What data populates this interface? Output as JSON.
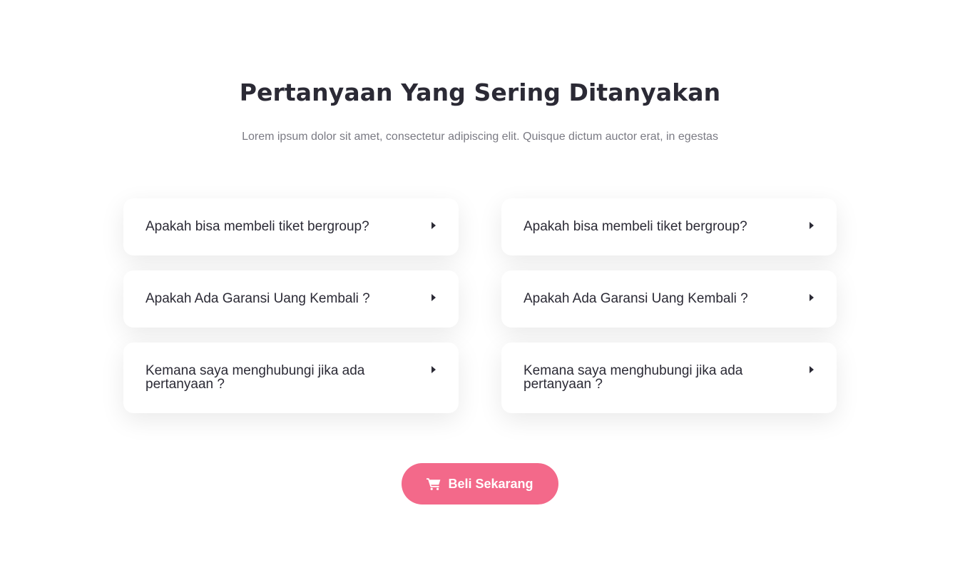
{
  "section": {
    "title": "Pertanyaan Yang Sering Ditanyakan",
    "subtitle": "Lorem ipsum dolor sit amet, consectetur adipiscing elit. Quisque dictum auctor erat, in egestas"
  },
  "faq": {
    "left": [
      {
        "question": "Apakah bisa membeli tiket bergroup?",
        "icon": "caret-right-icon"
      },
      {
        "question": "Apakah Ada Garansi Uang Kembali ?",
        "icon": "caret-right-icon"
      },
      {
        "question": "Kemana saya menghubungi jika ada pertanyaan ?",
        "icon": "caret-right-icon"
      }
    ],
    "right": [
      {
        "question": "Apakah bisa membeli tiket bergroup?",
        "icon": "caret-right-icon"
      },
      {
        "question": "Apakah Ada Garansi Uang Kembali ?",
        "icon": "caret-right-icon"
      },
      {
        "question": "Kemana saya menghubungi jika ada pertanyaan ?",
        "icon": "caret-right-icon"
      }
    ]
  },
  "cta": {
    "label": "Beli Sekarang",
    "icon": "shopping-cart-icon"
  },
  "colors": {
    "accent": "#f3698a",
    "heading": "#2b2a35",
    "muted": "#7a7a83",
    "background": "#ffffff"
  }
}
